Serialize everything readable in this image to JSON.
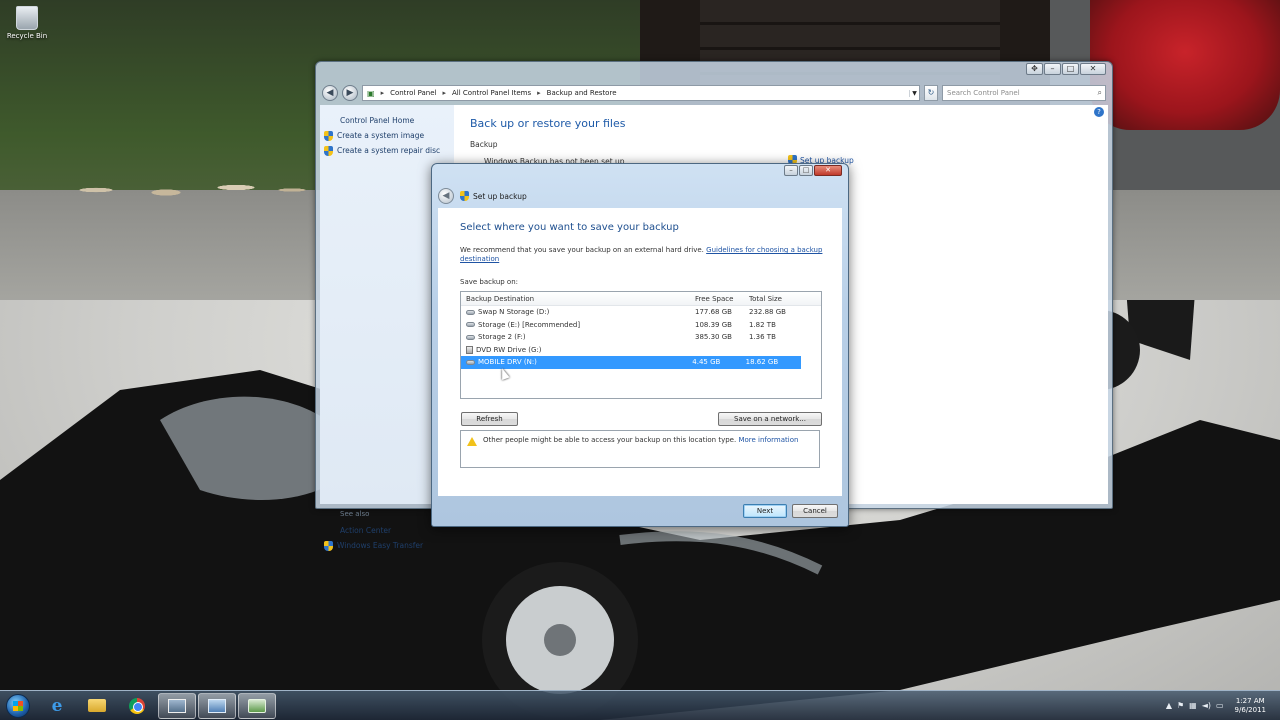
{
  "desktop": {
    "icon_label": "Recycle Bin"
  },
  "control_panel": {
    "breadcrumb": [
      "Control Panel",
      "All Control Panel Items",
      "Backup and Restore"
    ],
    "search_placeholder": "Search Control Panel",
    "sidebar": {
      "home": "Control Panel Home",
      "links": [
        "Create a system image",
        "Create a system repair disc"
      ],
      "see_also_label": "See also",
      "see_also": [
        "Action Center",
        "Windows Easy Transfer"
      ]
    },
    "main": {
      "title": "Back up or restore your files",
      "section": "Backup",
      "status": "Windows Backup has not been set up.",
      "setup_link": "Set up backup"
    }
  },
  "dialog": {
    "title": "Set up backup",
    "heading": "Select where you want to save your backup",
    "intro_text": "We recommend that you save your backup on an external hard drive.",
    "intro_link": "Guidelines for choosing a backup destination",
    "save_on_label": "Save backup on:",
    "columns": {
      "name": "Backup Destination",
      "free": "Free Space",
      "total": "Total Size"
    },
    "rows": [
      {
        "name": "Swap N Storage (D:)",
        "free": "177.68 GB",
        "total": "232.88 GB",
        "type": "drive",
        "selected": false
      },
      {
        "name": "Storage (E:) [Recommended]",
        "free": "108.39 GB",
        "total": "1.82 TB",
        "type": "drive",
        "selected": false
      },
      {
        "name": "Storage 2 (F:)",
        "free": "385.30 GB",
        "total": "1.36 TB",
        "type": "drive",
        "selected": false
      },
      {
        "name": "DVD RW Drive (G:)",
        "free": "",
        "total": "",
        "type": "dvd",
        "selected": false
      },
      {
        "name": "MOBILE DRV (N:)",
        "free": "4.45 GB",
        "total": "18.62 GB",
        "type": "drive",
        "selected": true
      }
    ],
    "refresh_label": "Refresh",
    "network_label": "Save on a network...",
    "warning_text": "Other people might be able to access your backup on this location type.",
    "warning_link": "More information",
    "next_label": "Next",
    "cancel_label": "Cancel"
  },
  "taskbar": {
    "clock_time": "1:27 AM",
    "clock_date": "9/6/2011"
  }
}
